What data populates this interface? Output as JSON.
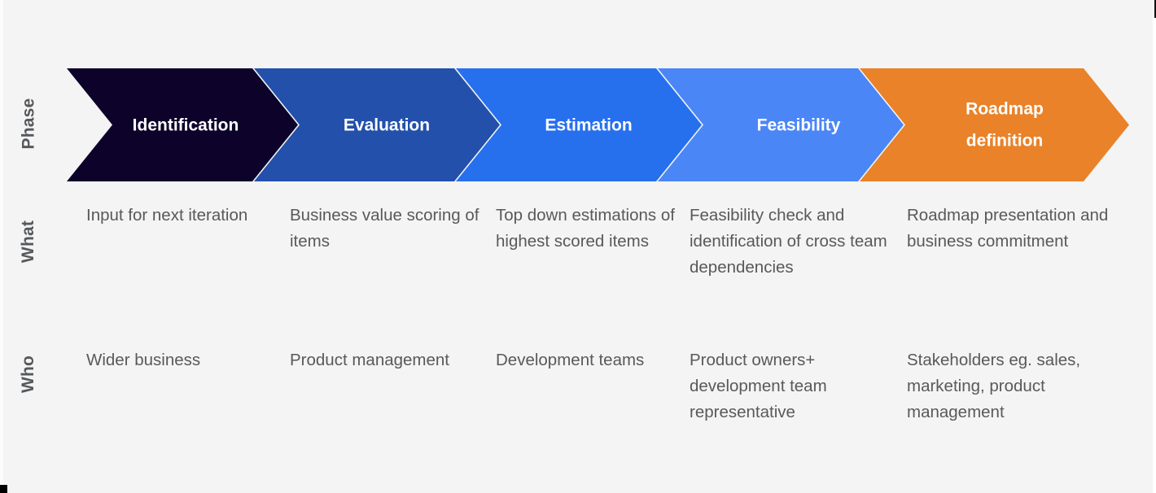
{
  "background_color": "#f4f4f4",
  "text_color": "#58595b",
  "label_color": "#56595c",
  "rows": {
    "phase_label": "Phase",
    "what_label": "What",
    "who_label": "Who"
  },
  "phases": [
    {
      "name": "Identification",
      "color": "#0d0229",
      "what": "Input for next iteration",
      "who": "Wider business"
    },
    {
      "name": "Evaluation",
      "color": "#2350ab",
      "what": "Business value scoring of items",
      "who": "Product management"
    },
    {
      "name": "Estimation",
      "color": "#2670ee",
      "what": "Top down estimations of highest scored items",
      "who": "Development teams"
    },
    {
      "name": "Feasibility",
      "color": "#4b86f7",
      "what": "Feasibility check and identification of cross team dependencies",
      "who": "Product owners+ development team representative"
    },
    {
      "name": "Roadmap definition",
      "name_line1": "Roadmap",
      "name_line2": "definition",
      "color": "#e98228",
      "what": "Roadmap presentation and business commitment",
      "who": "Stakeholders eg. sales, marketing, product management"
    }
  ],
  "chart_data": {
    "type": "table",
    "title": "Phase / What / Who process flow",
    "columns": [
      "Identification",
      "Evaluation",
      "Estimation",
      "Feasibility",
      "Roadmap definition"
    ],
    "rows": [
      {
        "label": "Phase",
        "values": [
          "Identification",
          "Evaluation",
          "Estimation",
          "Feasibility",
          "Roadmap definition"
        ]
      },
      {
        "label": "What",
        "values": [
          "Input for next iteration",
          "Business value scoring of items",
          "Top down estimations of highest scored items",
          "Feasibility check and identification of cross team dependencies",
          "Roadmap presentation and business commitment"
        ]
      },
      {
        "label": "Who",
        "values": [
          "Wider business",
          "Product management",
          "Development teams",
          "Product owners+ development team representative",
          "Stakeholders eg. sales, marketing, product management"
        ]
      }
    ]
  }
}
